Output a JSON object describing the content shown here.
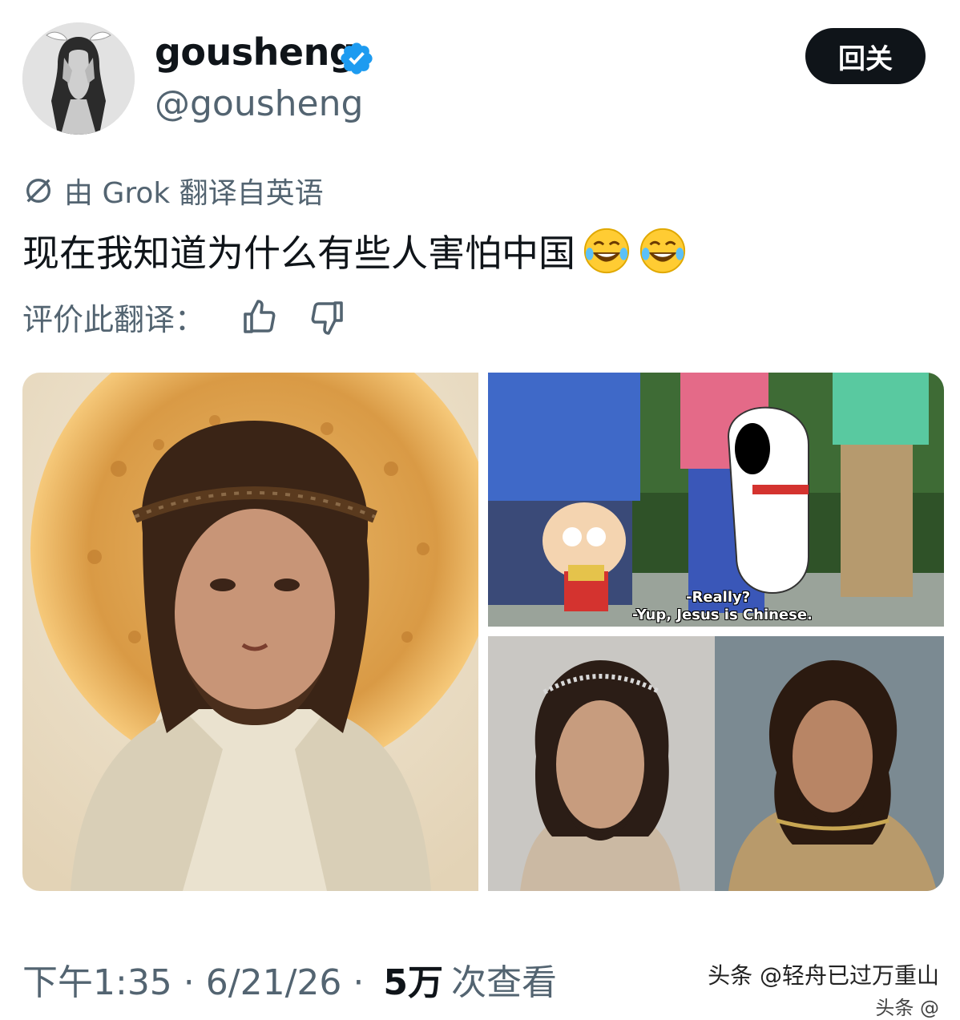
{
  "user": {
    "display_name": "gousheng",
    "handle": "@gousheng",
    "follow_label": "回关",
    "verified_color": "#1d9bf0"
  },
  "translation": {
    "note": "由 Grok 翻译自英语",
    "text": "现在我知道为什么有些人害怕中国",
    "emoji": [
      "😂",
      "😂"
    ],
    "rate_label": "评价此翻译："
  },
  "media": {
    "caption_line1": "-Really?",
    "caption_line2": "-Yup, Jesus is Chinese."
  },
  "meta": {
    "time": "下午1:35",
    "sep1": " · ",
    "date": "6/21/26",
    "sep2": " · ",
    "views": "5万",
    "views_label": "次查看"
  },
  "watermark": {
    "line1": "头条 @轻舟已过万重山",
    "line2": "头条 @"
  },
  "colors": {
    "text_primary": "#0f1419",
    "text_secondary": "#536471",
    "button_bg": "#0f1419"
  }
}
